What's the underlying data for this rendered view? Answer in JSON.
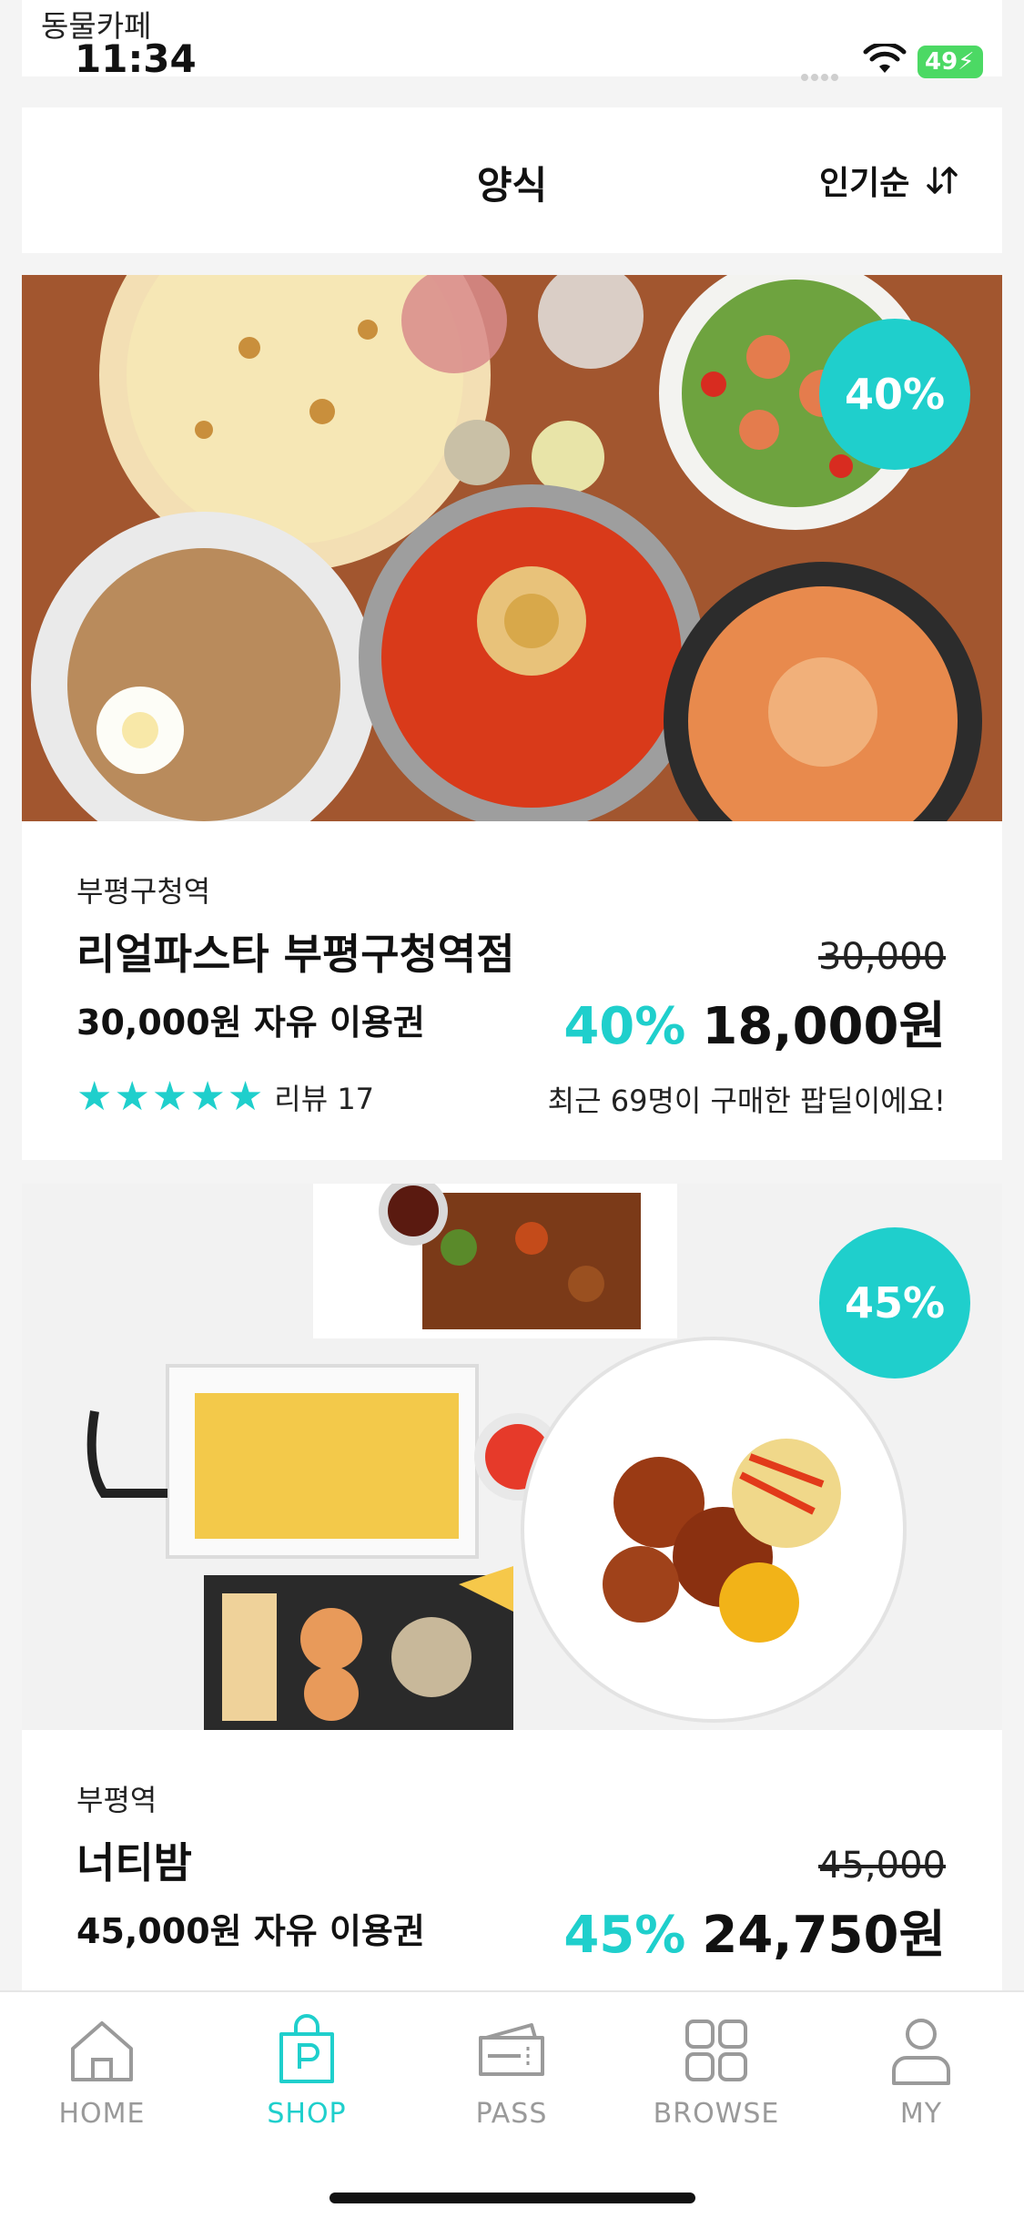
{
  "status_bar": {
    "back_app": "동물카페",
    "time": "11:34",
    "battery": "49"
  },
  "header": {
    "title": "양식",
    "sort_label": "인기순"
  },
  "colors": {
    "accent": "#1fcfcc",
    "nav_inactive": "#9a9a9a"
  },
  "deals": [
    {
      "discount_badge": "40%",
      "location": "부평구청역",
      "name": "리얼파스타 부평구청역점",
      "original_price": "30,000",
      "voucher": "30,000원 자유 이용권",
      "discount": "40%",
      "price": "18,000원",
      "rating_stars": 5,
      "review": "리뷰 17",
      "note": "최근 69명이 구매한 팝딜이에요!"
    },
    {
      "discount_badge": "45%",
      "location": "부평역",
      "name": "너티밤",
      "original_price": "45,000",
      "voucher": "45,000원 자유 이용권",
      "discount": "45%",
      "price": "24,750원"
    }
  ],
  "nav": [
    {
      "label": "HOME",
      "icon": "home-icon",
      "active": false
    },
    {
      "label": "SHOP",
      "icon": "shop-bag-icon",
      "active": true
    },
    {
      "label": "PASS",
      "icon": "pass-ticket-icon",
      "active": false
    },
    {
      "label": "BROWSE",
      "icon": "grid-icon",
      "active": false
    },
    {
      "label": "MY",
      "icon": "person-icon",
      "active": false
    }
  ]
}
